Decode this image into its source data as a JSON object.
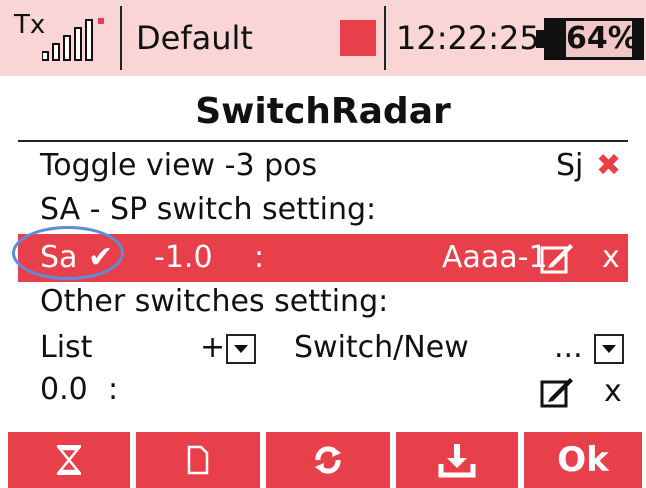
{
  "status_bar": {
    "tx_label": "Tx",
    "model_name": "Default",
    "time": "12:22:25",
    "battery_percent": "64%",
    "battery_level": 0.64,
    "signal_bars": 5
  },
  "title": "SwitchRadar",
  "toggle_row": {
    "label": "Toggle view -3 pos",
    "switch": "Sj",
    "remove": "✖"
  },
  "section_sa_sp": "SA - SP switch setting:",
  "selected_row": {
    "switch": "Sa",
    "check": "✔",
    "value": "-1.0",
    "separator": ":",
    "name": "Aaaa-1",
    "delete": "x"
  },
  "section_other": "Other switches setting:",
  "list_row": {
    "list_label": "List",
    "list_sign": "+",
    "switch_label": "Switch/New",
    "switch_value": "..."
  },
  "other_row": {
    "value": "0.0",
    "separator": ":",
    "delete": "x"
  },
  "toolbar": {
    "ok_label": "Ok"
  },
  "colors": {
    "accent_red": "#e8404a",
    "status_bar_bg": "#f9d5d5",
    "highlight_ring": "#5b8ed6"
  }
}
